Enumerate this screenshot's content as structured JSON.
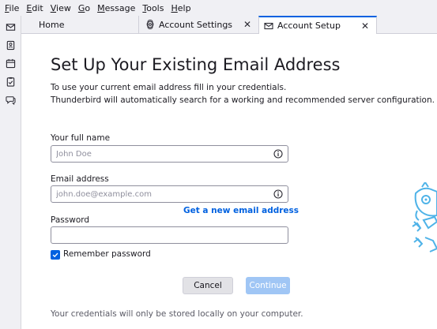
{
  "menubar": {
    "items": [
      {
        "acc": "F",
        "rest": "ile"
      },
      {
        "acc": "E",
        "rest": "dit"
      },
      {
        "acc": "V",
        "rest": "iew"
      },
      {
        "acc": "G",
        "rest": "o"
      },
      {
        "acc": "M",
        "rest": "essage"
      },
      {
        "acc": "T",
        "rest": "ools"
      },
      {
        "acc": "H",
        "rest": "elp"
      }
    ]
  },
  "spaces": {
    "icons": [
      "mail-icon",
      "address-book-icon",
      "calendar-icon",
      "tasks-icon",
      "chat-icon"
    ]
  },
  "tabs": {
    "home": "Home",
    "settings": "Account Settings",
    "setup": "Account Setup",
    "close_glyph": "✕"
  },
  "setup": {
    "title": "Set Up Your Existing Email Address",
    "intro_line1": "To use your current email address fill in your credentials.",
    "intro_line2": "Thunderbird will automatically search for a working and recommended server configuration.",
    "full_name_label": "Your full name",
    "full_name_placeholder": "John Doe",
    "full_name_value": "",
    "email_label": "Email address",
    "email_placeholder": "john.doe@example.com",
    "email_value": "",
    "get_new_email_link": "Get a new email address",
    "password_label": "Password",
    "password_value": "",
    "remember_password_label": "Remember password",
    "remember_password_checked": true,
    "cancel_button": "Cancel",
    "continue_button": "Continue",
    "footer_note": "Your credentials will only be stored locally on your computer."
  },
  "colors": {
    "accent": "#0061e0",
    "continue_disabled": "#a0c6f5",
    "mascot": "#4fb3e8"
  }
}
